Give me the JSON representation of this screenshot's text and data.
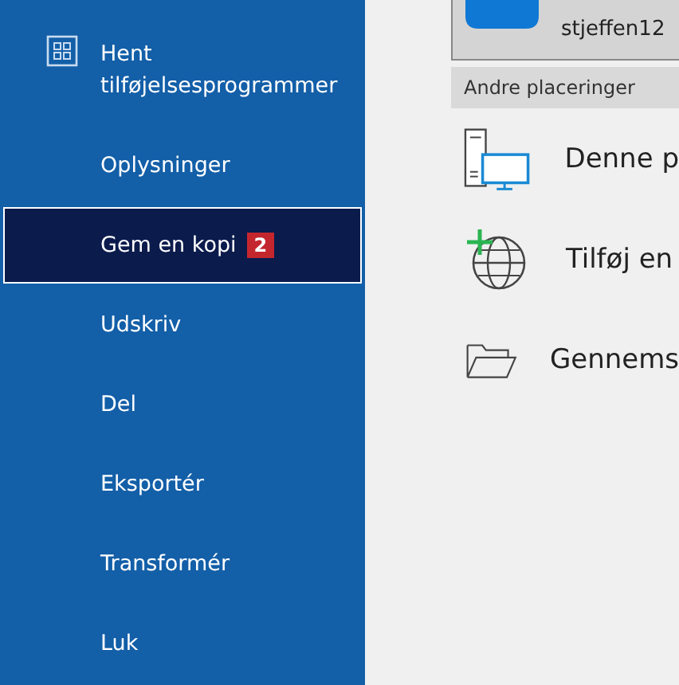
{
  "sidebar": {
    "items": [
      {
        "label": "Hent tilføjelsesprogrammer",
        "kind": "addins",
        "selected": false
      },
      {
        "label": "Oplysninger",
        "kind": "plain",
        "selected": false
      },
      {
        "label": "Gem en kopi",
        "kind": "plain",
        "selected": true,
        "badge": "2"
      },
      {
        "label": "Udskriv",
        "kind": "plain",
        "selected": false
      },
      {
        "label": "Del",
        "kind": "plain",
        "selected": false
      },
      {
        "label": "Eksportér",
        "kind": "plain",
        "selected": false
      },
      {
        "label": "Transformér",
        "kind": "plain",
        "selected": false
      },
      {
        "label": "Luk",
        "kind": "plain",
        "selected": false
      }
    ]
  },
  "account": {
    "name": "stjeffen12"
  },
  "section_header": "Andre placeringer",
  "locations": [
    {
      "label": "Denne p",
      "kind": "pc"
    },
    {
      "label": "Tilføj en",
      "kind": "web"
    },
    {
      "label": "Gennems",
      "kind": "folder"
    }
  ]
}
